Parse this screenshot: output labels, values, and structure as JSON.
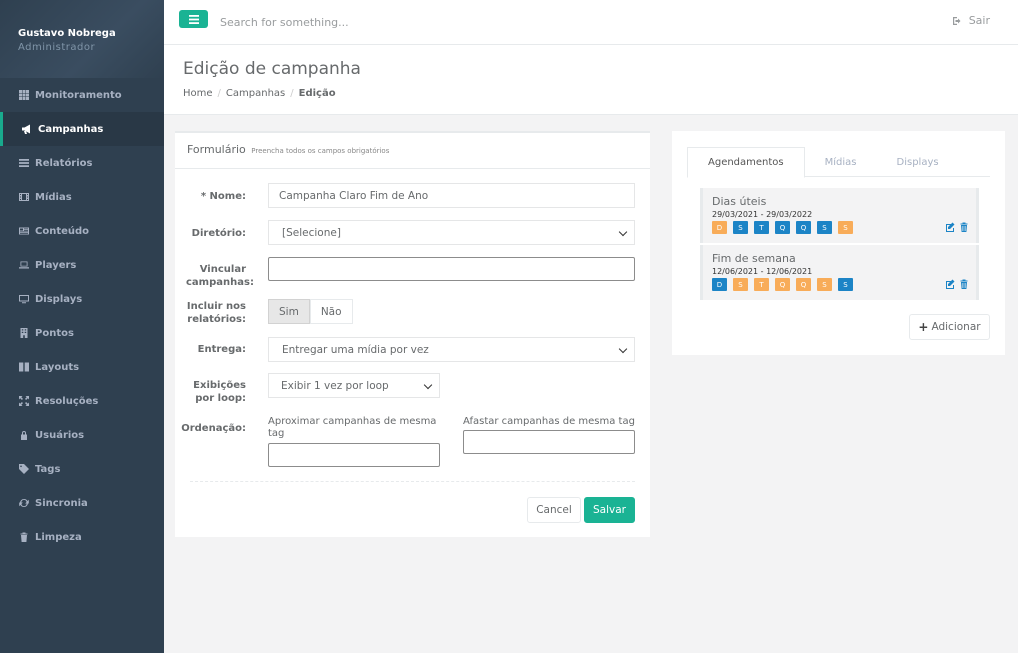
{
  "user": {
    "name": "Gustavo Nobrega",
    "role": "Administrador"
  },
  "sidebar": {
    "items": [
      {
        "label": "Monitoramento",
        "icon": "grid-icon"
      },
      {
        "label": "Campanhas",
        "icon": "bullhorn-icon",
        "active": true
      },
      {
        "label": "Relatórios",
        "icon": "list-icon"
      },
      {
        "label": "Mídias",
        "icon": "film-icon"
      },
      {
        "label": "Conteúdo",
        "icon": "newspaper-icon"
      },
      {
        "label": "Players",
        "icon": "laptop-icon"
      },
      {
        "label": "Displays",
        "icon": "monitor-icon"
      },
      {
        "label": "Pontos",
        "icon": "building-icon"
      },
      {
        "label": "Layouts",
        "icon": "columns-icon"
      },
      {
        "label": "Resoluções",
        "icon": "expand-icon"
      },
      {
        "label": "Usuários",
        "icon": "lock-icon"
      },
      {
        "label": "Tags",
        "icon": "tag-icon"
      },
      {
        "label": "Sincronia",
        "icon": "refresh-icon"
      },
      {
        "label": "Limpeza",
        "icon": "trash-icon"
      }
    ]
  },
  "topbar": {
    "search_placeholder": "Search for something...",
    "logout_label": "Sair"
  },
  "page": {
    "title": "Edição de campanha",
    "breadcrumb": [
      "Home",
      "Campanhas",
      "Edição"
    ]
  },
  "form": {
    "title": "Formulário",
    "subtitle": "Preencha todos os campos obrigatórios",
    "name_label": "* Nome:",
    "name_value": "Campanha Claro Fim de Ano",
    "directory_label": "Diretório:",
    "directory_value": "[Selecione]",
    "link_label": "Vincular campanhas:",
    "link_value": "",
    "include_label": "Incluir nos relatórios:",
    "include_yes": "Sim",
    "include_no": "Não",
    "delivery_label": "Entrega:",
    "delivery_value": "Entregar uma mídia por vez",
    "exhibitions_label": "Exibições por loop:",
    "exhibitions_value": "Exibir 1 vez por loop",
    "ordering_label": "Ordenação:",
    "approx_label": "Aproximar campanhas de mesma tag",
    "approx_value": "",
    "away_label": "Afastar campanhas de mesma tag",
    "away_value": "",
    "cancel_label": "Cancel",
    "save_label": "Salvar"
  },
  "side": {
    "tabs": [
      "Agendamentos",
      "Mídias",
      "Displays"
    ],
    "active_tab": "Agendamentos",
    "schedules": [
      {
        "title": "Dias úteis",
        "dates": "29/03/2021 - 29/03/2022",
        "days": [
          {
            "l": "D",
            "on": false
          },
          {
            "l": "S",
            "on": true
          },
          {
            "l": "T",
            "on": true
          },
          {
            "l": "Q",
            "on": true
          },
          {
            "l": "Q",
            "on": true
          },
          {
            "l": "S",
            "on": true
          },
          {
            "l": "S",
            "on": false
          }
        ]
      },
      {
        "title": "Fim de semana",
        "dates": "12/06/2021 - 12/06/2021",
        "days": [
          {
            "l": "D",
            "on": true
          },
          {
            "l": "S",
            "on": false
          },
          {
            "l": "T",
            "on": false
          },
          {
            "l": "Q",
            "on": false
          },
          {
            "l": "Q",
            "on": false
          },
          {
            "l": "S",
            "on": false
          },
          {
            "l": "S",
            "on": true
          }
        ]
      }
    ],
    "add_label": "Adicionar"
  },
  "colors": {
    "accent": "#1ab394",
    "day_on": "#1c84c6",
    "day_off": "#f8ac59",
    "sidebar": "#2f4050"
  }
}
